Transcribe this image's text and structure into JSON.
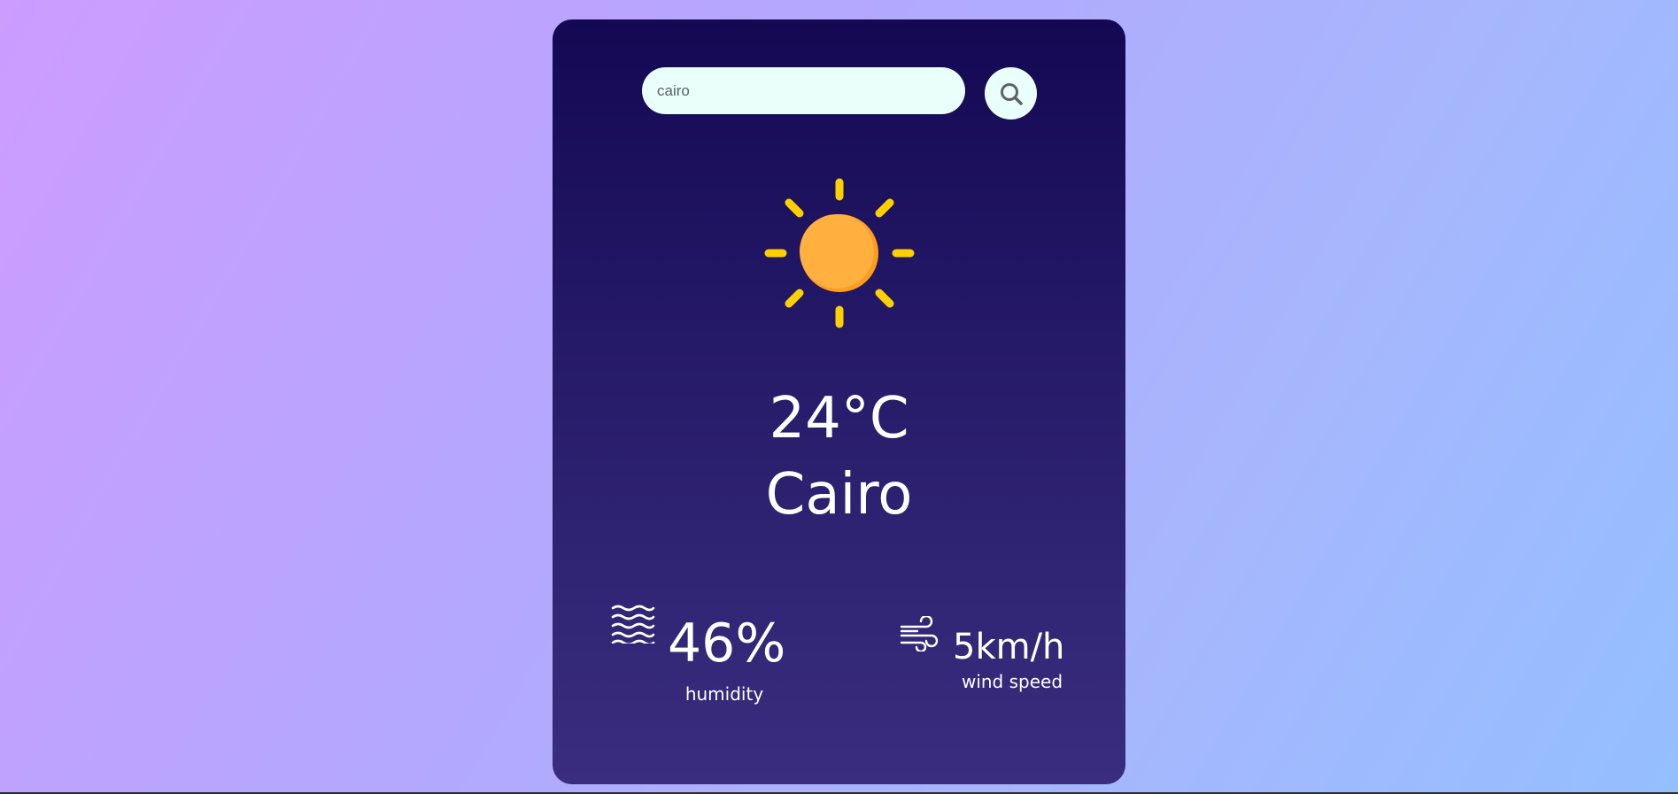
{
  "search": {
    "value": "cairo",
    "button_icon": "search-icon"
  },
  "weather": {
    "icon": "sun-icon",
    "temperature": "24°C",
    "city": "Cairo"
  },
  "details": {
    "humidity": {
      "icon": "humidity-icon",
      "value": "46%",
      "label": "humidity"
    },
    "wind": {
      "icon": "wind-icon",
      "value": "5km/h",
      "label": "wind speed"
    }
  },
  "colors": {
    "background_start": "#cc9cff",
    "background_end": "#94bfff",
    "card_top": "#140853",
    "card_bottom": "#3a2d7f",
    "input_bg": "#e9fff9",
    "sun_body": "#ffb03f",
    "sun_shade": "#ff9d1a",
    "sun_rays": "#ffd000"
  }
}
